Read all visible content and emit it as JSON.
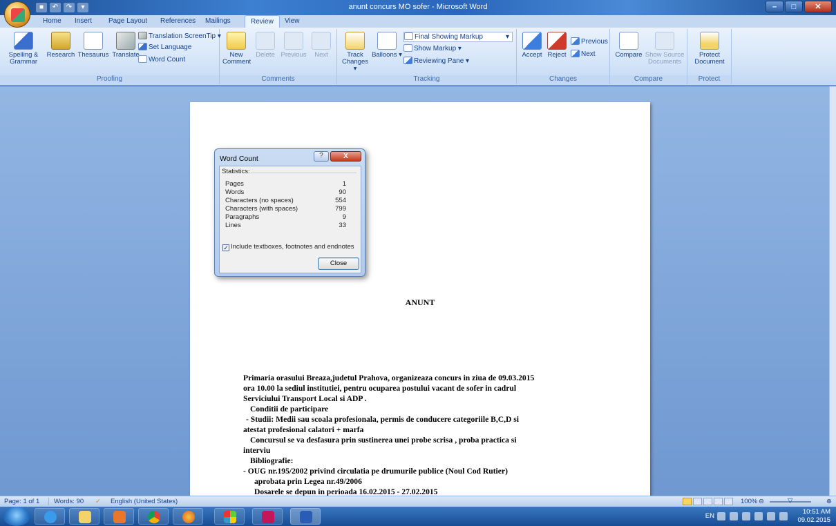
{
  "window": {
    "title": "anunt concurs MO sofer - Microsoft Word"
  },
  "tabs": [
    "Home",
    "Insert",
    "Page Layout",
    "References",
    "Mailings",
    "Review",
    "View"
  ],
  "active_tab": "Review",
  "ribbon": {
    "proofing": {
      "label": "Proofing",
      "spelling": "Spelling & Grammar",
      "research": "Research",
      "thesaurus": "Thesaurus",
      "translate": "Translate",
      "translation_screentip": "Translation ScreenTip",
      "set_language": "Set Language",
      "word_count": "Word Count"
    },
    "comments": {
      "label": "Comments",
      "new_comment": "New Comment",
      "delete": "Delete",
      "previous": "Previous",
      "next": "Next"
    },
    "tracking": {
      "label": "Tracking",
      "track_changes": "Track Changes",
      "balloons": "Balloons",
      "markup_select": "Final Showing Markup",
      "show_markup": "Show Markup",
      "reviewing_pane": "Reviewing Pane"
    },
    "changes": {
      "label": "Changes",
      "accept": "Accept",
      "reject": "Reject",
      "previous": "Previous",
      "next": "Next"
    },
    "compare": {
      "label": "Compare",
      "compare": "Compare",
      "show_source": "Show Source Documents"
    },
    "protect": {
      "label": "Protect",
      "protect_document": "Protect Document"
    }
  },
  "dialog": {
    "title": "Word Count",
    "help": "?",
    "close_x": "X",
    "statistics_label": "Statistics:",
    "stats": [
      {
        "label": "Pages",
        "value": "1"
      },
      {
        "label": "Words",
        "value": "90"
      },
      {
        "label": "Characters (no spaces)",
        "value": "554"
      },
      {
        "label": "Characters (with spaces)",
        "value": "799"
      },
      {
        "label": "Paragraphs",
        "value": "9"
      },
      {
        "label": "Lines",
        "value": "33"
      }
    ],
    "include_checkbox": "Include textboxes, footnotes and endnotes",
    "include_checked": true,
    "close_button": "Close"
  },
  "document": {
    "heading": "ANUNT",
    "paragraphs": [
      "Primaria orasului Breaza,judetul Prahova, organizeaza concurs in ziua de 09.03.2015",
      "ora 10.00 la sediul institutiei, pentru ocuparea postului vacant de sofer in cadrul",
      "Serviciului Transport Local si ADP .",
      "Conditii de participare",
      "- Studii: Medii sau scoala profesionala, permis de conducere categoriile B,C,D si",
      "atestat profesional calatori + marfa",
      "Concursul se va desfasura prin sustinerea unei probe scrisa , proba practica si",
      "interviu",
      "Bibliografie:",
      "- OUG nr.195/2002 privind circulatia pe drumurile publice (Noul Cod Rutier)",
      "aprobata prin Legea nr.49/2006",
      "Dosarele se depun in perioada 16.02.2015 - 27.02.2015"
    ]
  },
  "statusbar": {
    "page": "Page: 1 of 1",
    "words": "Words: 90",
    "language": "English (United States)",
    "zoom": "100%"
  },
  "taskbar": {
    "lang": "EN",
    "time": "10:51 AM",
    "date": "09.02.2015"
  }
}
